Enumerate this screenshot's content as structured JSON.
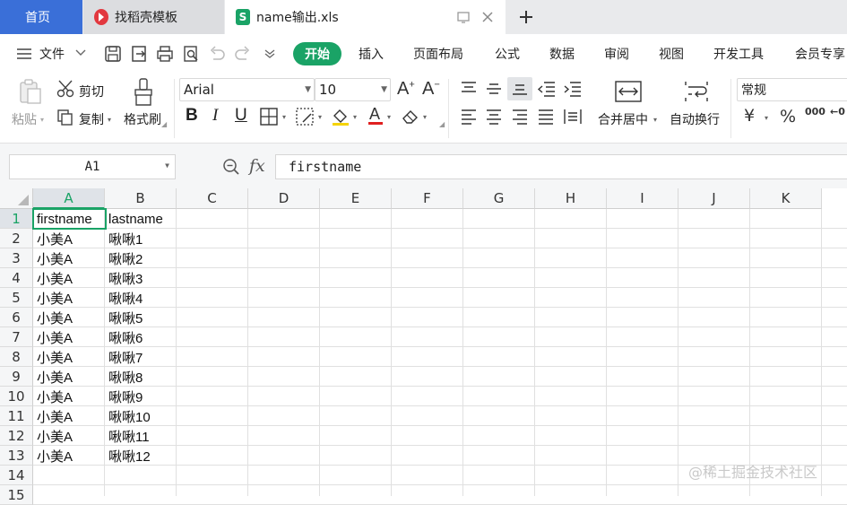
{
  "tabs": {
    "home": "首页",
    "template": "找稻壳模板",
    "file": "name输出.xls",
    "file_icon": "S",
    "template_icon": "D"
  },
  "menu": {
    "file": "文件",
    "start": "开始",
    "items": [
      "插入",
      "页面布局",
      "公式",
      "数据",
      "审阅",
      "视图",
      "开发工具",
      "会员专享"
    ]
  },
  "ribbon": {
    "paste": "粘贴",
    "cut": "剪切",
    "copy": "复制",
    "format_painter": "格式刷",
    "font_name": "Arial",
    "font_size": "10",
    "merge_center": "合并居中",
    "wrap_text": "自动换行",
    "number_format": "常规",
    "currency_symbol": "¥",
    "percent_symbol": "%",
    "thousands": "000",
    "decimal": "←0"
  },
  "formula_bar": {
    "name_box": "A1",
    "fx": "fx",
    "content": "firstname"
  },
  "sheet": {
    "columns": [
      "A",
      "B",
      "C",
      "D",
      "E",
      "F",
      "G",
      "H",
      "I",
      "J",
      "K"
    ],
    "rows": [
      "1",
      "2",
      "3",
      "4",
      "5",
      "6",
      "7",
      "8",
      "9",
      "10",
      "11",
      "12",
      "13",
      "14",
      "15"
    ],
    "cells": [
      [
        "firstname",
        "lastname"
      ],
      [
        "小美A",
        "啾啾1"
      ],
      [
        "小美A",
        "啾啾2"
      ],
      [
        "小美A",
        "啾啾3"
      ],
      [
        "小美A",
        "啾啾4"
      ],
      [
        "小美A",
        "啾啾5"
      ],
      [
        "小美A",
        "啾啾6"
      ],
      [
        "小美A",
        "啾啾7"
      ],
      [
        "小美A",
        "啾啾8"
      ],
      [
        "小美A",
        "啾啾9"
      ],
      [
        "小美A",
        "啾啾10"
      ],
      [
        "小美A",
        "啾啾11"
      ],
      [
        "小美A",
        "啾啾12"
      ]
    ]
  },
  "watermark": "@稀土掘金技术社区",
  "colors": {
    "accent_green": "#1aa366",
    "home_tab_blue": "#3a6fd8",
    "file_icon_green": "#1aa366",
    "template_icon_red": "#e2383f"
  }
}
